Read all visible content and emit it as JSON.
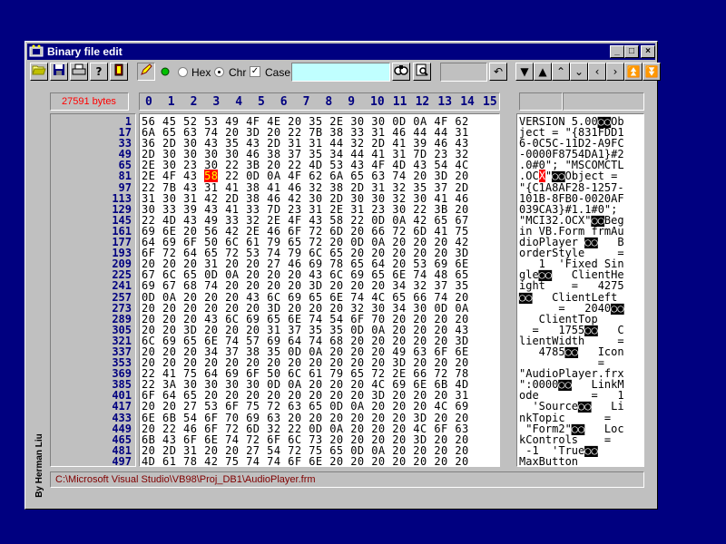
{
  "window": {
    "title": "Binary file edit"
  },
  "toolbar": {
    "hex_label": "Hex",
    "chr_label": "Chr",
    "case_label": "Case",
    "mode_selected": "Chr",
    "case_checked": "✓",
    "search_value": "",
    "goto_value": ""
  },
  "file": {
    "size_text": "27591 bytes",
    "path": "C:\\Microsoft Visual Studio\\VB98\\Proj_DB1\\AudioPlayer.frm",
    "author": "By Herman Liu"
  },
  "column_headers": [
    "0",
    "1",
    "2",
    "3",
    "4",
    "5",
    "6",
    "7",
    "8",
    "9",
    "10",
    "11",
    "12",
    "13",
    "14",
    "15"
  ],
  "offsets": [
    "1",
    "17",
    "33",
    "49",
    "65",
    "81",
    "97",
    "113",
    "129",
    "145",
    "161",
    "177",
    "193",
    "209",
    "225",
    "241",
    "257",
    "273",
    "289",
    "305",
    "321",
    "337",
    "353",
    "369",
    "385",
    "401",
    "417",
    "433",
    "449",
    "465",
    "481",
    "497"
  ],
  "hex_rows": [
    "56 45 52 53 49 4F 4E 20 35 2E 30 30 0D 0A 4F 62",
    "6A 65 63 74 20 3D 20 22 7B 38 33 31 46 44 44 31",
    "36 2D 30 43 35 43 2D 31 31 44 32 2D 41 39 46 43",
    "2D 30 30 30 30 46 38 37 35 34 44 41 31 7D 23 32",
    "2E 30 23 30 22 3B 20 22 4D 53 43 4F 4D 43 54 4C",
    "2E 4F 43 58 22 0D 0A 4F 62 6A 65 63 74 20 3D 20",
    "22 7B 43 31 41 38 41 46 32 38 2D 31 32 35 37 2D",
    "31 30 31 42 2D 38 46 42 30 2D 30 30 32 30 41 46",
    "30 33 39 43 41 33 7D 23 31 2E 31 23 30 22 3B 20",
    "22 4D 43 49 33 32 2E 4F 43 58 22 0D 0A 42 65 67",
    "69 6E 20 56 42 2E 46 6F 72 6D 20 66 72 6D 41 75",
    "64 69 6F 50 6C 61 79 65 72 20 0D 0A 20 20 20 42",
    "6F 72 64 65 72 53 74 79 6C 65 20 20 20 20 20 3D",
    "20 20 20 31 20 20 27 46 69 78 65 64 20 53 69 6E",
    "67 6C 65 0D 0A 20 20 20 43 6C 69 65 6E 74 48 65",
    "69 67 68 74 20 20 20 20 3D 20 20 20 34 32 37 35",
    "0D 0A 20 20 20 43 6C 69 65 6E 74 4C 65 66 74 20",
    "20 20 20 20 20 20 3D 20 20 20 32 30 34 30 0D 0A",
    "20 20 20 43 6C 69 65 6E 74 54 6F 70 20 20 20 20",
    "20 20 3D 20 20 20 31 37 35 35 0D 0A 20 20 20 43",
    "6C 69 65 6E 74 57 69 64 74 68 20 20 20 20 20 3D",
    "20 20 20 34 37 38 35 0D 0A 20 20 20 49 63 6F 6E",
    "20 20 20 20 20 20 20 20 20 20 20 20 3D 20 20 20",
    "22 41 75 64 69 6F 50 6C 61 79 65 72 2E 66 72 78",
    "22 3A 30 30 30 30 0D 0A 20 20 20 4C 69 6E 6B 4D",
    "6F 64 65 20 20 20 20 20 20 20 20 3D 20 20 20 31",
    "20 20 27 53 6F 75 72 63 65 0D 0A 20 20 20 4C 69",
    "6E 6B 54 6F 70 69 63 20 20 20 20 20 20 3D 20 20",
    "20 22 46 6F 72 6D 32 22 0D 0A 20 20 20 4C 6F 63",
    "6B 43 6F 6E 74 72 6F 6C 73 20 20 20 20 3D 20 20",
    "20 2D 31 20 20 27 54 72 75 65 0D 0A 20 20 20 20",
    "4D 61 78 42 75 74 74 6F 6E 20 20 20 20 20 20 20"
  ],
  "highlighted_byte": "58",
  "text_rows": [
    "VERSION 5.00◙◙Ob",
    "ject = \"{831FDD1",
    "6-0C5C-11D2-A9FC",
    "-0000F8754DA1}#2",
    ".0#0\"; \"MSCOMCTL",
    ".OC",
    "\"{C1A8AF28-1257-",
    "101B-8FB0-0020AF",
    "039CA3}#1.1#0\";",
    "\"MCI32.OCX\"◙◙Beg",
    "in VB.Form frmAu",
    "dioPlayer ◙◙   B",
    "orderStyle     =",
    "   1  'Fixed Sin",
    "gle◙◙   ClientHe",
    "ight    =   4275",
    "◙◙   ClientLeft ",
    "      =   2040◙◙",
    "   ClientTop    ",
    "  =   1755◙◙   C",
    "lientWidth     =",
    "   4785◙◙   Icon",
    "            =   ",
    "\"AudioPlayer.frx",
    "\":0000◙◙   LinkM",
    "ode        =   1",
    "  'Source◙◙   Li",
    "nkTopic      =  ",
    " \"Form2\"◙◙   Loc",
    "kControls    =  ",
    " -1  'True◙◙    ",
    "MaxButton       "
  ],
  "text_row5_char": "X",
  "text_row5_tail": "\"◙◙Object = ",
  "icons": [
    "open-folder-icon",
    "save-disk-icon",
    "print-icon",
    "help-icon",
    "exit-door-icon",
    "pen-icon",
    "green-light-icon",
    "binoculars-find-icon",
    "find-next-icon",
    "undo-icon",
    "first-page-icon",
    "scroll-top-icon",
    "scroll-up-icon",
    "scroll-down-icon",
    "scroll-left-icon",
    "scroll-right-icon",
    "page-up-icon",
    "last-page-icon"
  ]
}
